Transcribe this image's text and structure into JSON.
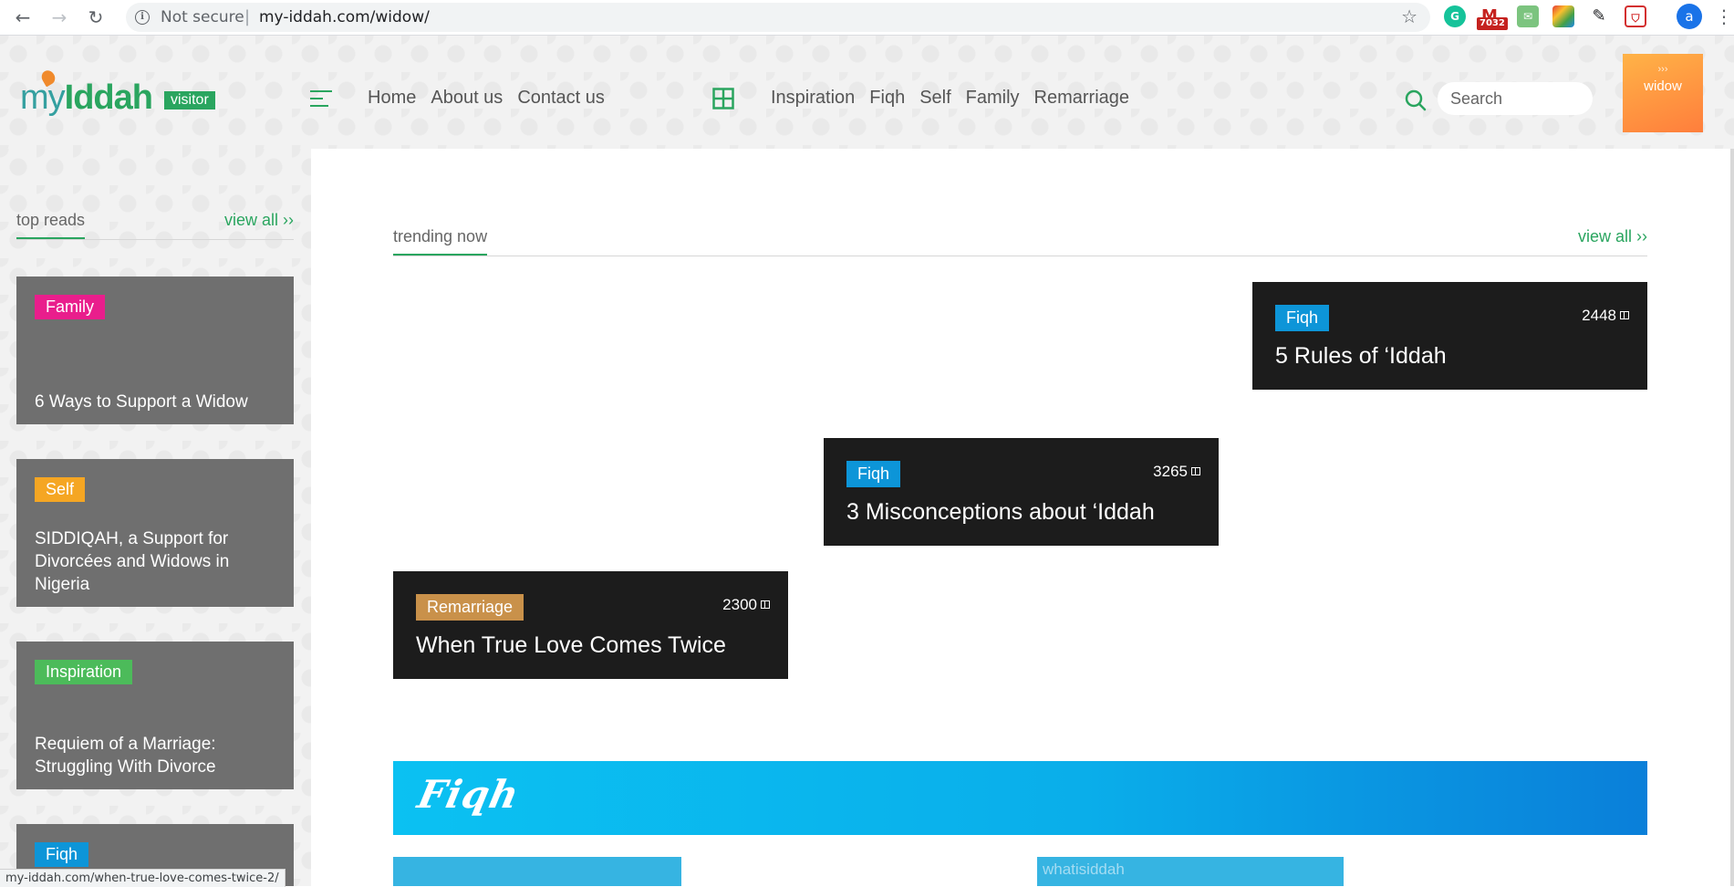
{
  "browser": {
    "security_label": "Not secure",
    "url": "my-iddah.com/widow/",
    "extension_badge": "7032",
    "profile_initial": "a"
  },
  "header": {
    "logo_my": "my",
    "logo_iddah": "Iddah",
    "visitor_badge": "visitor",
    "primary_nav": [
      "Home",
      "About us",
      "Contact us"
    ],
    "category_nav": [
      "Inspiration",
      "Fiqh",
      "Self",
      "Family",
      "Remarriage"
    ],
    "search_placeholder": "Search",
    "widow_tile": {
      "chevron": "›››",
      "label": "widow"
    }
  },
  "sidebar": {
    "heading": "top reads",
    "view_all": "view all ››",
    "cards": [
      {
        "tag": "Family",
        "tag_color": "#e91e8c",
        "title": "6 Ways to Support a Widow"
      },
      {
        "tag": "Self",
        "tag_color": "#f5a623",
        "title": "SIDDIQAH, a Support for Divorcées and Widows in Nigeria"
      },
      {
        "tag": "Inspiration",
        "tag_color": "#4cbb5a",
        "title": "Requiem of a Marriage: Struggling With Divorce"
      },
      {
        "tag": "Fiqh",
        "tag_color": "#0d95d8",
        "title": ""
      }
    ]
  },
  "trending": {
    "heading": "trending now",
    "view_all": "view all ››",
    "cards": [
      {
        "tag": "Fiqh",
        "tag_color": "#0d95d8",
        "views": "2448",
        "title": "5 Rules of ‘Iddah"
      },
      {
        "tag": "Fiqh",
        "tag_color": "#0d95d8",
        "views": "3265",
        "title": "3 Misconceptions about ‘Iddah"
      },
      {
        "tag": "Remarriage",
        "tag_color": "#c9914a",
        "views": "2300",
        "title": "When True Love Comes Twice"
      }
    ]
  },
  "fiqh_section": {
    "banner_title": "Fiqh",
    "image_alt": "whatisiddah"
  },
  "status_bar": {
    "link": "my-iddah.com/when-true-love-comes-twice-2/"
  },
  "colors": {
    "brand_green": "#2aa55f",
    "card_dark": "#1c1c1c",
    "card_gray": "#6f6f6f",
    "fiqh_blue": "#0bc1f2"
  }
}
